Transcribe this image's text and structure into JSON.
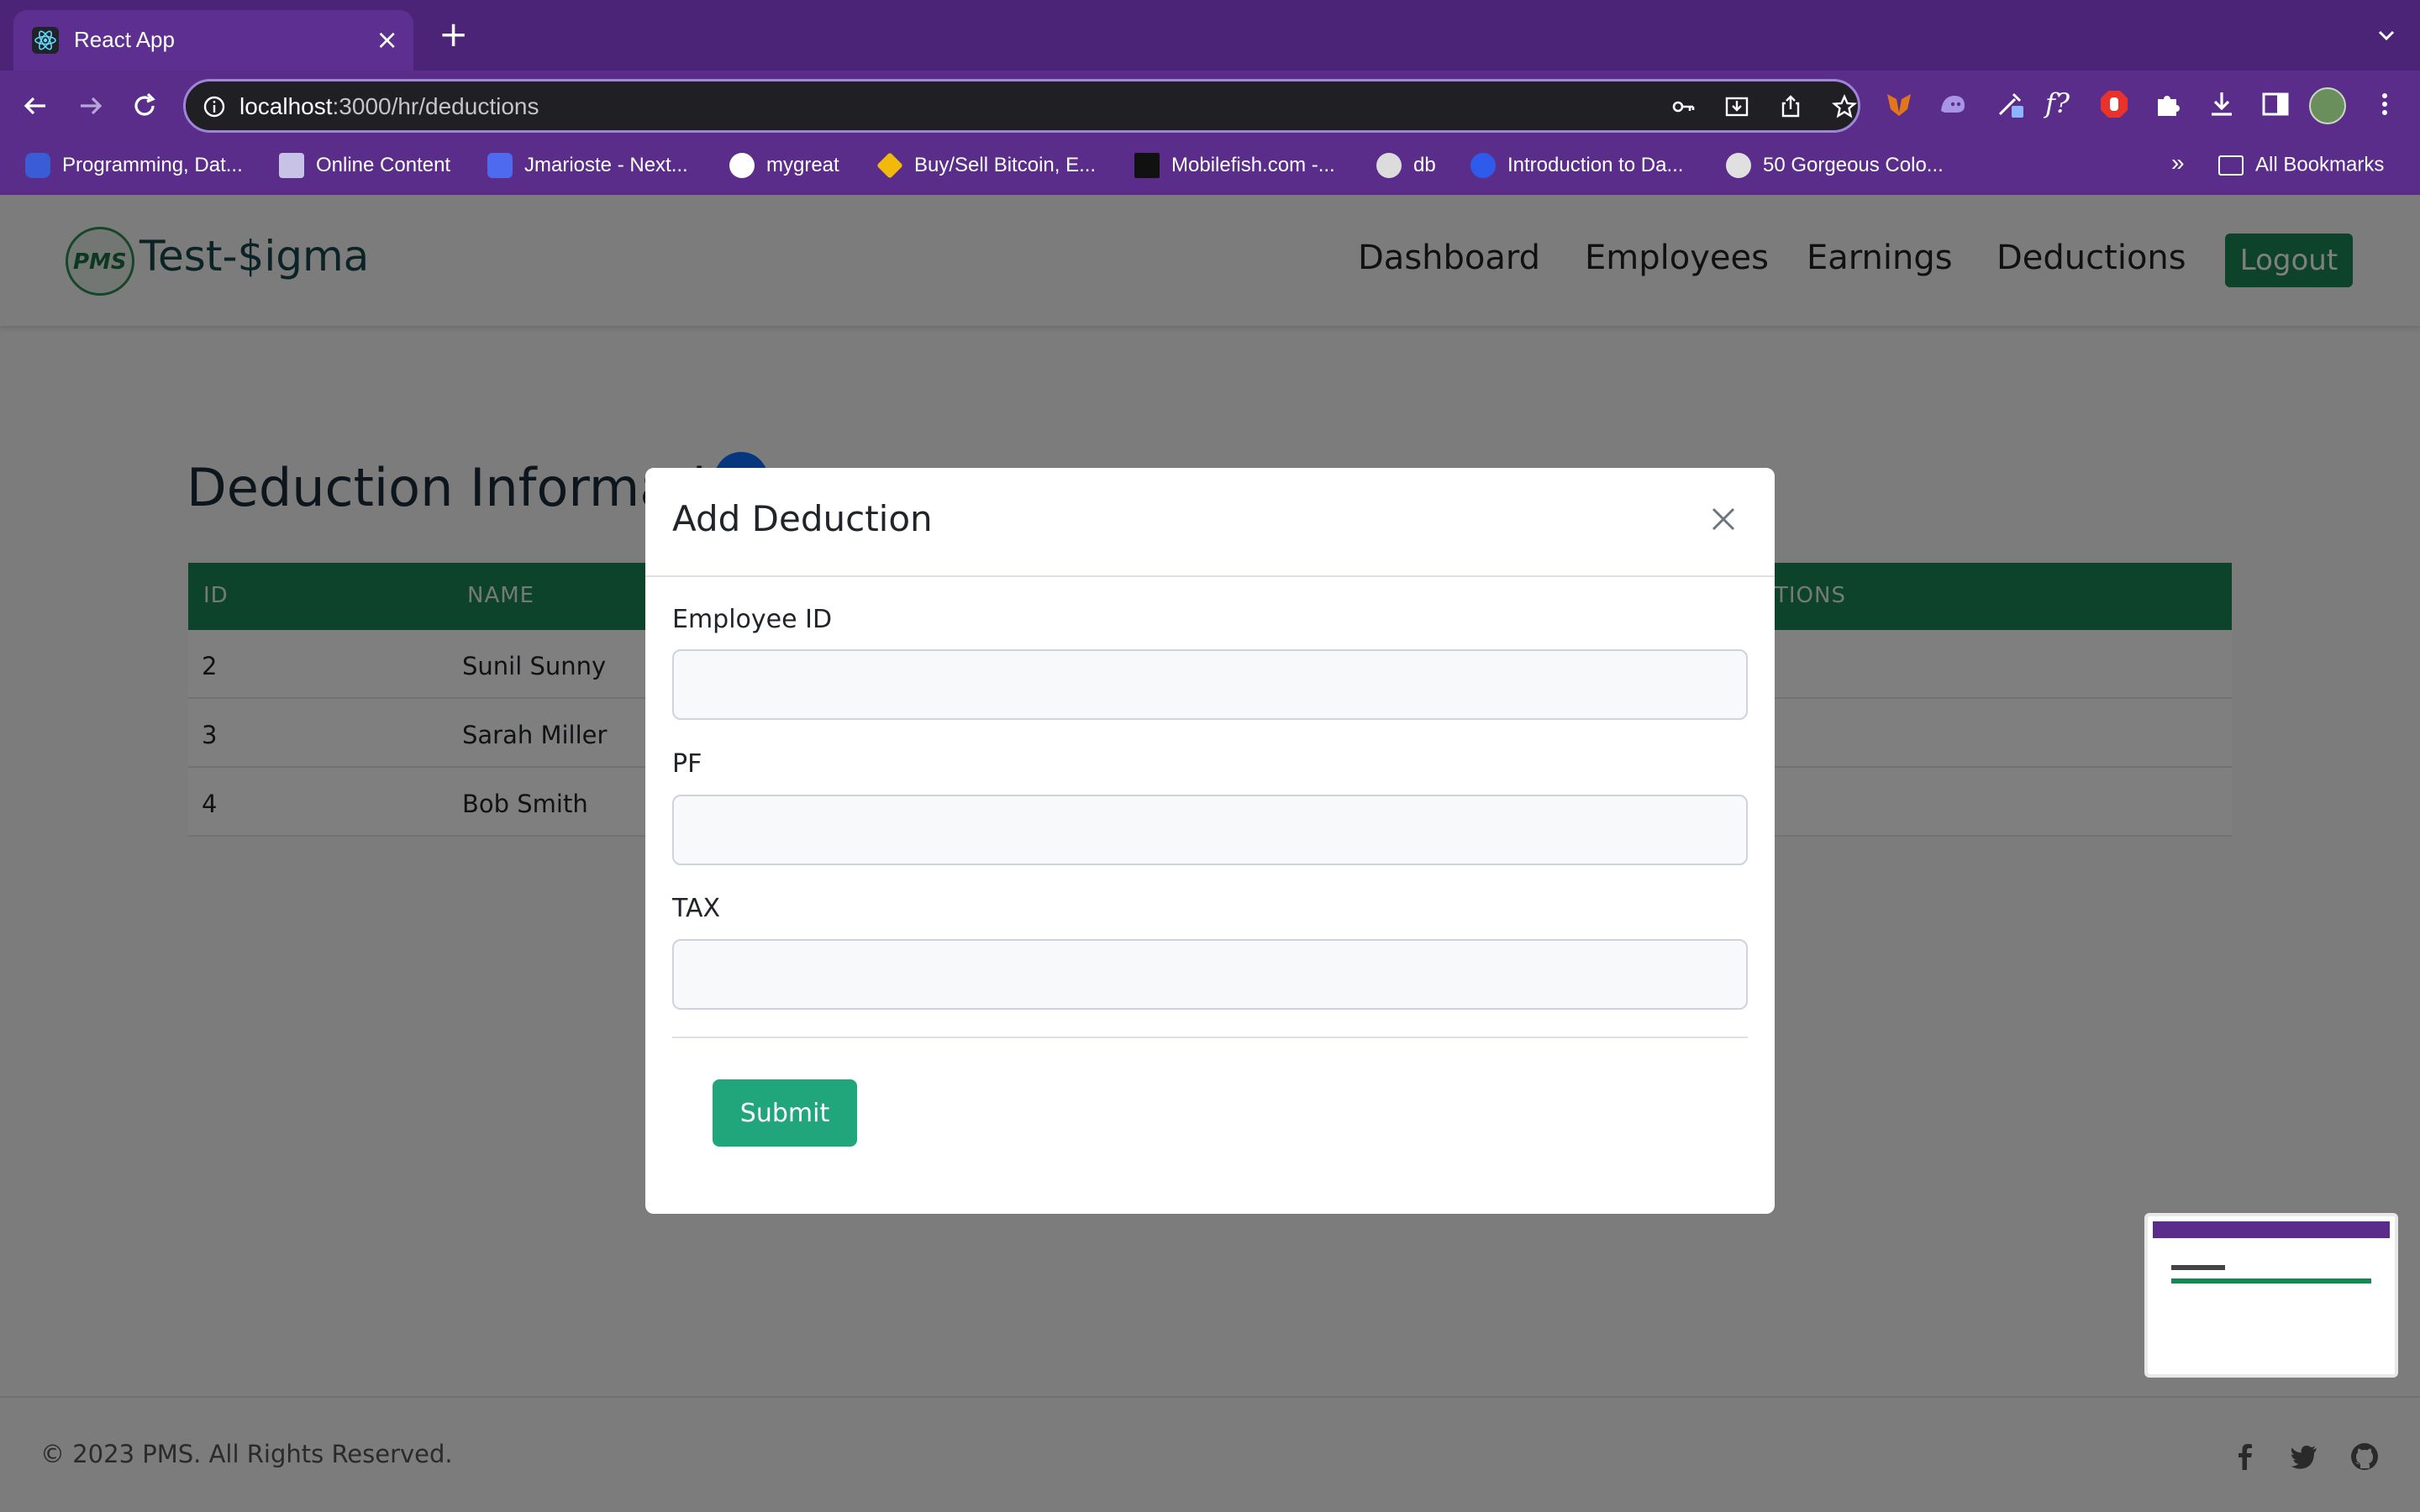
{
  "browser": {
    "tab_title": "React App",
    "url_host": "localhost",
    "url_path": ":3000/hr/deductions",
    "bookmarks": [
      "Programming, Dat...",
      "Online Content",
      "Jmarioste - Next...",
      "mygreat",
      "Buy/Sell Bitcoin, E...",
      "Mobilefish.com -...",
      "db",
      "Introduction to Da...",
      "50 Gorgeous Colo..."
    ],
    "bookmarks_overflow": "»",
    "all_bookmarks": "All Bookmarks"
  },
  "navbar": {
    "brand_logo_text": "PMS",
    "brand_name": "Test-$igma",
    "links": [
      "Dashboard",
      "Employees",
      "Earnings",
      "Deductions"
    ],
    "logout_label": "Logout"
  },
  "main": {
    "heading": "Deduction Informati",
    "table": {
      "headers": [
        "ID",
        "NAME",
        "TIONS"
      ],
      "rows": [
        {
          "id": "2",
          "name": "Sunil Sunny"
        },
        {
          "id": "3",
          "name": "Sarah Miller"
        },
        {
          "id": "4",
          "name": "Bob Smith"
        }
      ]
    }
  },
  "modal": {
    "title": "Add Deduction",
    "fields": [
      {
        "label": "Employee ID",
        "value": ""
      },
      {
        "label": "PF",
        "value": ""
      },
      {
        "label": "TAX",
        "value": ""
      }
    ],
    "submit_label": "Submit"
  },
  "footer": {
    "copyright": "© 2023 PMS. All Rights Reserved.",
    "social_icons": [
      "facebook-icon",
      "twitter-icon",
      "github-icon"
    ]
  },
  "colors": {
    "browser_frame": "#5a2d8a",
    "primary_green": "#198754",
    "submit_green": "#20a67a",
    "overlay": "rgba(0,0,0,0.5)"
  }
}
